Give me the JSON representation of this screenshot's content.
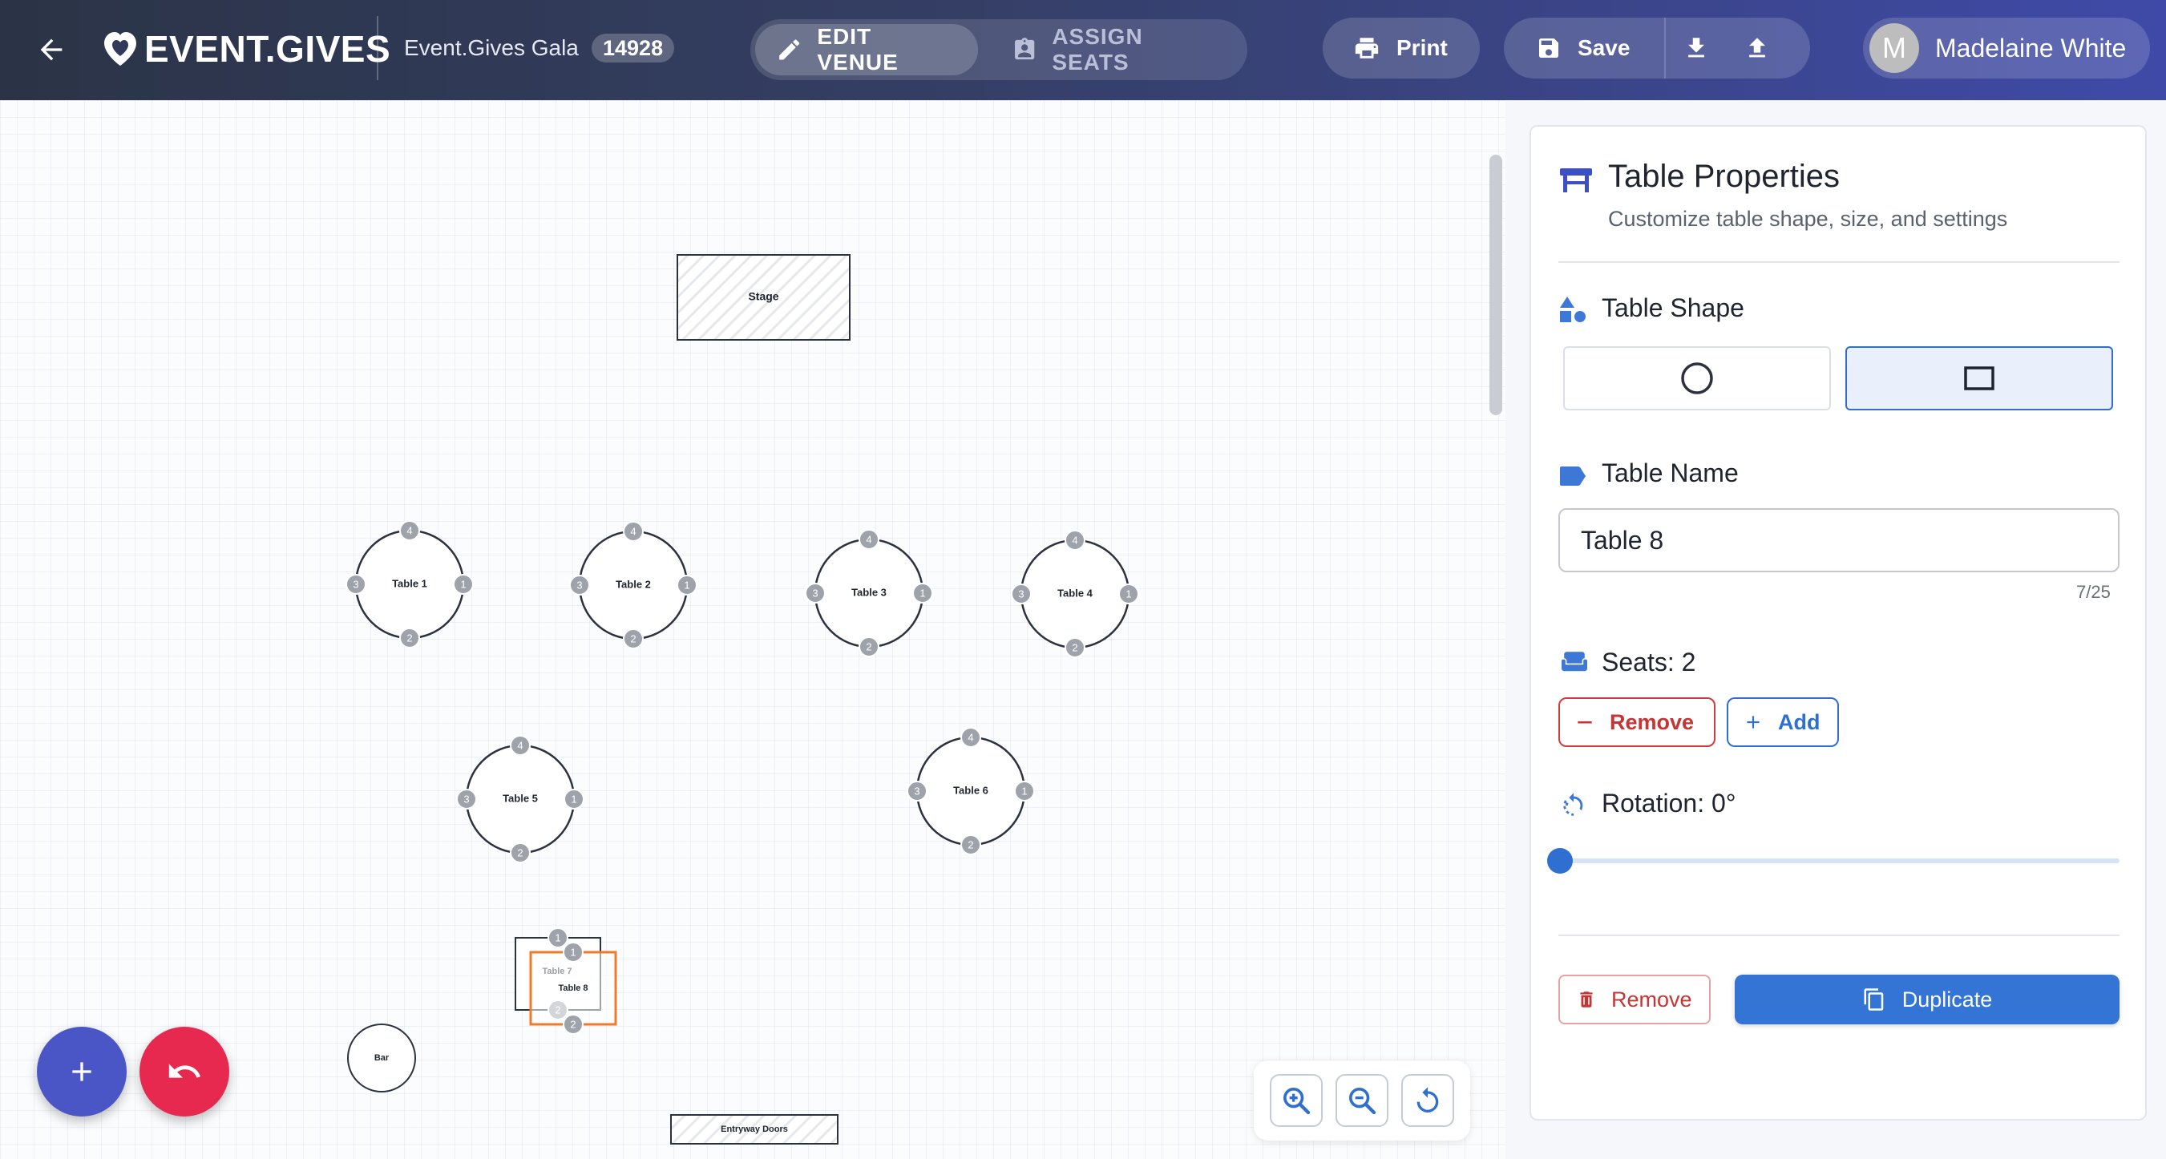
{
  "app": {
    "logo_text": "EVENT.GIVES",
    "event_name": "Event.Gives Gala",
    "event_id": "14928"
  },
  "modes": {
    "edit_label": "EDIT VENUE",
    "assign_label": "ASSIGN SEATS",
    "active": "edit"
  },
  "toolbar": {
    "print_label": "Print",
    "save_label": "Save"
  },
  "user": {
    "initial": "M",
    "name": "Madelaine White"
  },
  "venue": {
    "fixtures": [
      {
        "id": "stage",
        "label": "Stage"
      },
      {
        "id": "bar",
        "label": "Bar"
      },
      {
        "id": "entry",
        "label": "Entryway Doors"
      }
    ],
    "tables": [
      {
        "label": "Table 1",
        "shape": "round",
        "seats": [
          "1",
          "2",
          "3",
          "4"
        ]
      },
      {
        "label": "Table 2",
        "shape": "round",
        "seats": [
          "1",
          "2",
          "3",
          "4"
        ]
      },
      {
        "label": "Table 3",
        "shape": "round",
        "seats": [
          "1",
          "2",
          "3",
          "4"
        ]
      },
      {
        "label": "Table 4",
        "shape": "round",
        "seats": [
          "1",
          "2",
          "3",
          "4"
        ]
      },
      {
        "label": "Table 5",
        "shape": "round",
        "seats": [
          "1",
          "2",
          "3",
          "4"
        ]
      },
      {
        "label": "Table 6",
        "shape": "round",
        "seats": [
          "1",
          "2",
          "3",
          "4"
        ]
      },
      {
        "label": "Table 7",
        "shape": "square",
        "seats": [
          "1",
          "2"
        ]
      },
      {
        "label": "Table 8",
        "shape": "square",
        "seats": [
          "1",
          "2"
        ],
        "selected": true
      }
    ]
  },
  "properties": {
    "title": "Table Properties",
    "subtitle": "Customize table shape, size, and settings",
    "shape_label": "Table Shape",
    "shape_options": [
      "round",
      "square"
    ],
    "shape_selected": "square",
    "name_label": "Table Name",
    "name_value": "Table 8",
    "name_count": "7/25",
    "seats_label": "Seats: 2",
    "remove_seat_label": "Remove",
    "add_seat_label": "Add",
    "rotation_label": "Rotation: 0°",
    "rotation_value": 0,
    "remove_table_label": "Remove",
    "duplicate_label": "Duplicate"
  },
  "colors": {
    "accent": "#2f6fd0",
    "danger": "#d23b3b",
    "selected_table": "#f07a2b",
    "fab_add": "#4a55c6",
    "fab_undo": "#e8294f"
  }
}
